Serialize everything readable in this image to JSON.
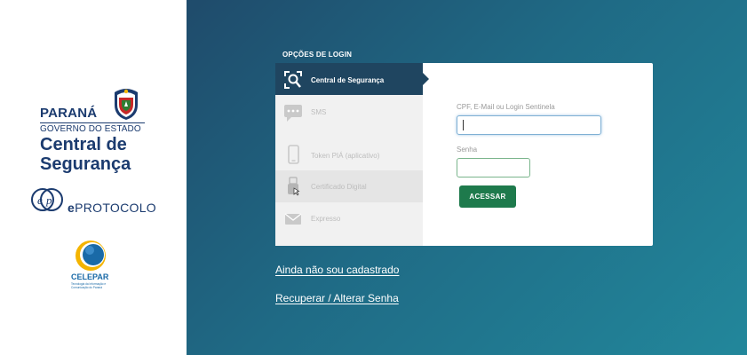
{
  "branding": {
    "parana": "PARANÁ",
    "governo": "GOVERNO DO ESTADO",
    "central_line1": "Central de",
    "central_line2": "Segurança",
    "eprotocolo_e": "e",
    "eprotocolo_rest": "PROTOCOLO",
    "celepar_name": "CELEPAR",
    "celepar_sub": "Tecnologia da Informação e Comunicação do Paraná"
  },
  "login": {
    "section_title": "OPÇÕES DE LOGIN",
    "options": [
      {
        "label": "Central de Segurança",
        "icon": "security-scan-icon",
        "active": true
      },
      {
        "label": "SMS",
        "icon": "chat-bubble-icon",
        "active": false
      },
      {
        "label": "Token PIÁ (aplicativo)",
        "icon": "smartphone-icon",
        "active": false
      },
      {
        "label": "Certificado Digital",
        "icon": "usb-token-icon",
        "active": false
      },
      {
        "label": "Expresso",
        "icon": "envelope-icon",
        "active": false
      }
    ],
    "form": {
      "user_label": "CPF, E-Mail ou Login Sentinela",
      "user_value": "",
      "password_label": "Senha",
      "password_value": "",
      "submit_label": "ACESSAR"
    }
  },
  "links": {
    "register": "Ainda não sou cadastrado",
    "recover": "Recuperar / Alterar Senha"
  },
  "colors": {
    "brand_navy": "#1b3b6f",
    "active_menu": "#1f4560",
    "button_green": "#1e7a4c",
    "gradient_start": "#1f4b6b",
    "gradient_end": "#22879b"
  }
}
